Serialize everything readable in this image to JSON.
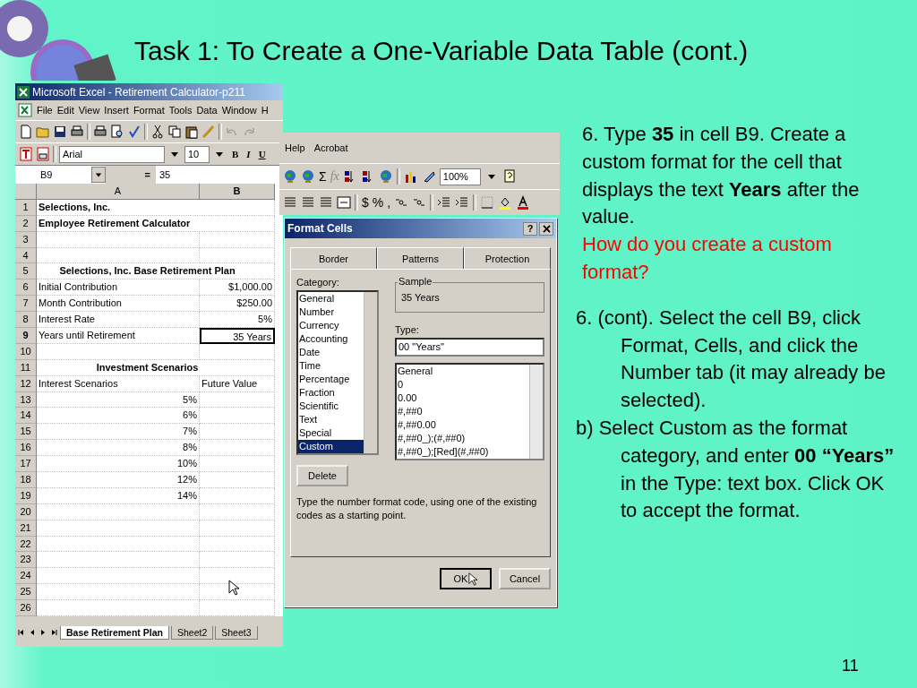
{
  "slide": {
    "title": "Task 1: To Create a One-Variable Data Table (cont.)",
    "page_number": "11"
  },
  "excel": {
    "title": "Microsoft Excel - Retirement Calculator-p211",
    "menu": [
      "File",
      "Edit",
      "View",
      "Insert",
      "Format",
      "Tools",
      "Data",
      "Window",
      "H"
    ],
    "menu_extra": [
      "Help",
      "Acrobat"
    ],
    "font_name": "Arial",
    "font_size": "10",
    "format_buttons": [
      "B",
      "I",
      "U"
    ],
    "zoom": "100%",
    "sum_glyph": "Σ",
    "function_glyph": "fx",
    "currency_glyph": "$",
    "percent_glyph": "%",
    "comma_glyph": ",",
    "name_box": "B9",
    "formula_equals": "=",
    "formula": "35",
    "columns": [
      "A",
      "B"
    ],
    "rows": [
      {
        "number": "1",
        "selected": false,
        "cells": [
          {
            "text": "Selections, Inc.",
            "kind": "title",
            "selected": false
          }
        ]
      },
      {
        "number": "2",
        "selected": false,
        "cells": [
          {
            "text": "Employee Retirement Calculator",
            "kind": "title",
            "selected": false
          }
        ]
      },
      {
        "number": "3",
        "selected": false,
        "cells": []
      },
      {
        "number": "4",
        "selected": false,
        "cells": []
      },
      {
        "number": "5",
        "selected": false,
        "cells": [
          {
            "text": "Selections, Inc. Base Retirement Plan",
            "kind": "heading",
            "selected": false
          }
        ]
      },
      {
        "number": "6",
        "selected": false,
        "cells": [
          {
            "text": "Initial Contribution",
            "kind": "text",
            "selected": false
          },
          {
            "text": "$1,000.00",
            "kind": "number",
            "selected": false
          }
        ]
      },
      {
        "number": "7",
        "selected": false,
        "cells": [
          {
            "text": "Month Contribution",
            "kind": "text",
            "selected": false
          },
          {
            "text": "$250.00",
            "kind": "number",
            "selected": false
          }
        ]
      },
      {
        "number": "8",
        "selected": false,
        "cells": [
          {
            "text": "Interest Rate",
            "kind": "text",
            "selected": false
          },
          {
            "text": "5%",
            "kind": "number",
            "selected": false
          }
        ]
      },
      {
        "number": "9",
        "selected": true,
        "cells": [
          {
            "text": "Years until Retirement",
            "kind": "text",
            "selected": false
          },
          {
            "text": "35 Years",
            "kind": "number",
            "selected": true
          }
        ]
      },
      {
        "number": "10",
        "selected": false,
        "cells": []
      },
      {
        "number": "11",
        "selected": false,
        "cells": [
          {
            "text": "Investment Scenarios",
            "kind": "heading",
            "selected": false
          }
        ]
      },
      {
        "number": "12",
        "selected": false,
        "cells": [
          {
            "text": "Interest Scenarios",
            "kind": "text",
            "selected": false
          },
          {
            "text": "Future Value",
            "kind": "text",
            "selected": false
          }
        ]
      },
      {
        "number": "13",
        "selected": false,
        "cells": [
          {
            "text": "5%",
            "kind": "number",
            "selected": false
          }
        ]
      },
      {
        "number": "14",
        "selected": false,
        "cells": [
          {
            "text": "6%",
            "kind": "number",
            "selected": false
          }
        ]
      },
      {
        "number": "15",
        "selected": false,
        "cells": [
          {
            "text": "7%",
            "kind": "number",
            "selected": false
          }
        ]
      },
      {
        "number": "16",
        "selected": false,
        "cells": [
          {
            "text": "8%",
            "kind": "number",
            "selected": false
          }
        ]
      },
      {
        "number": "17",
        "selected": false,
        "cells": [
          {
            "text": "10%",
            "kind": "number",
            "selected": false
          }
        ]
      },
      {
        "number": "18",
        "selected": false,
        "cells": [
          {
            "text": "12%",
            "kind": "number",
            "selected": false
          }
        ]
      },
      {
        "number": "19",
        "selected": false,
        "cells": [
          {
            "text": "14%",
            "kind": "number",
            "selected": false
          }
        ]
      },
      {
        "number": "20",
        "selected": false,
        "cells": []
      },
      {
        "number": "21",
        "selected": false,
        "cells": []
      },
      {
        "number": "22",
        "selected": false,
        "cells": []
      },
      {
        "number": "23",
        "selected": false,
        "cells": []
      },
      {
        "number": "24",
        "selected": false,
        "cells": []
      },
      {
        "number": "25",
        "selected": false,
        "cells": []
      },
      {
        "number": "26",
        "selected": false,
        "cells": []
      }
    ],
    "sheet_tabs": [
      {
        "label": "Base Retirement Plan",
        "selected": true
      },
      {
        "label": "Sheet2",
        "selected": false
      },
      {
        "label": "Sheet3",
        "selected": false
      }
    ]
  },
  "dialog": {
    "title": "Format Cells",
    "help": "?",
    "tabs": [
      "Border",
      "Patterns",
      "Protection"
    ],
    "category_label": "Category:",
    "categories": [
      {
        "label": "General",
        "selected": false
      },
      {
        "label": "Number",
        "selected": false
      },
      {
        "label": "Currency",
        "selected": false
      },
      {
        "label": "Accounting",
        "selected": false
      },
      {
        "label": "Date",
        "selected": false
      },
      {
        "label": "Time",
        "selected": false
      },
      {
        "label": "Percentage",
        "selected": false
      },
      {
        "label": "Fraction",
        "selected": false
      },
      {
        "label": "Scientific",
        "selected": false
      },
      {
        "label": "Text",
        "selected": false
      },
      {
        "label": "Special",
        "selected": false
      },
      {
        "label": "Custom",
        "selected": true
      }
    ],
    "sample_label": "Sample",
    "sample": "35 Years",
    "type_label": "Type:",
    "type_value": "00 \"Years\"",
    "types": [
      "General",
      "0",
      "0.00",
      "#,##0",
      "#,##0.00",
      "#,##0_);(#,##0)",
      "#,##0_);[Red](#,##0)"
    ],
    "delete_button": "Delete",
    "hint": "Type the number format code, using one of the existing codes as a starting point.",
    "ok_button": "OK",
    "cancel_button": "Cancel"
  },
  "notes": [
    {
      "kind": "instruction",
      "text": "6. Type **35** in cell B9. Create a custom format for the cell that displays the text **Years** after the value."
    },
    {
      "kind": "question",
      "text": "How do you create a custom format?"
    }
  ],
  "steps": [
    {
      "text": "6. (cont). Select the cell B9, click Format, Cells, and click the Number tab (it may already be selected)."
    },
    {
      "text": "b)  Select Custom as the format category, and enter **00 “Years”** in the Type: text box. Click OK to accept the format."
    }
  ]
}
